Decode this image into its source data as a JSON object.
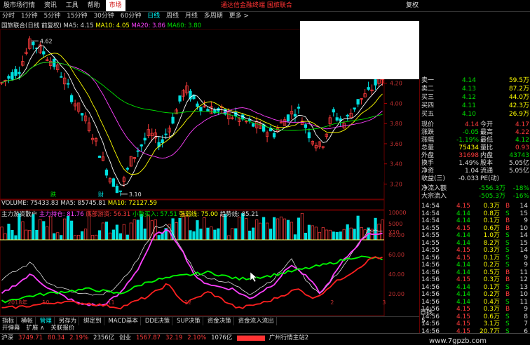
{
  "menu": {
    "items": [
      "股市场行情",
      "资讯",
      "工具",
      "帮助",
      "市场"
    ],
    "promo": "通达信金融终端  国旅联合",
    "right_label": "复权"
  },
  "periods": {
    "items": [
      "分时",
      "1分钟",
      "5分钟",
      "15分钟",
      "30分钟",
      "60分钟",
      "日线",
      "周线",
      "月线",
      "多周期",
      "更多 >"
    ],
    "selected_index": 6
  },
  "main_chart": {
    "legend_name": "国旅联合(日线 前复权)",
    "ma5": "MA5: 4.15",
    "ma10": "MA10: 4.05",
    "ma20": "MA20: 3.86",
    "ma60": "MA60: 3.80",
    "high_label": "4.62",
    "low_label": "3.10",
    "hint_left": "跌",
    "hint_right": "财",
    "y_ticks": [
      "4.20",
      "4.00",
      "3.80",
      "3.60",
      "3.40",
      "3.20"
    ]
  },
  "volume_chart": {
    "label": "VOLUME: 75433.83",
    "ma5": "MA5: 85745.81",
    "ma10": "MA10: 72127.59",
    "y_ticks": [
      "10000",
      "5000",
      "X10"
    ]
  },
  "indicator_chart": {
    "name": "主力游资散户",
    "l1": "主力持仓: 81.76",
    "l2": "底部游资: 56.31",
    "l3": "小散买入: 57.51",
    "l4": "强弱线: 75.00",
    "l5": "趋势线: 85.21",
    "y_ticks": [
      "80.00",
      "60.00",
      "40.00",
      "20.00"
    ]
  },
  "x_axis": {
    "labels": [
      "2018年",
      "10",
      "11",
      "12",
      "2",
      "3"
    ]
  },
  "quotes": {
    "sell": [
      {
        "name": "卖一",
        "price": "4.14",
        "vol": "59.5万"
      },
      {
        "name": "卖二",
        "price": "4.13",
        "vol": "87.2万"
      },
      {
        "name": "买三",
        "price": "4.12",
        "vol": "44.0万"
      },
      {
        "name": "买四",
        "price": "4.11",
        "vol": "42.3万"
      },
      {
        "name": "买五",
        "price": "4.10",
        "vol": "26.9万"
      }
    ],
    "stats": [
      [
        "现价",
        "4.14",
        "今开",
        "4.17"
      ],
      [
        "涨跌",
        "-0.05",
        "最高",
        "4.22"
      ],
      [
        "涨幅",
        "-1.19%",
        "最低",
        "4.12"
      ],
      [
        "总量",
        "75434",
        "量比",
        "0.93"
      ],
      [
        "外盘",
        "31698",
        "内盘",
        "43743"
      ],
      [
        "换手",
        "1.49%",
        "股本",
        "5.05亿"
      ],
      [
        "净资",
        "1.04",
        "流通",
        "5.05亿"
      ],
      [
        "收益(三)",
        "-0.033",
        "PE(动)",
        ""
      ]
    ],
    "flow": [
      [
        "净流入额",
        "-556.3万",
        "-18%"
      ],
      [
        "大宗流入",
        "-505.3万",
        "-16%"
      ]
    ],
    "ticks": [
      [
        "14:54",
        "4.15",
        "0.3万",
        "B",
        "14"
      ],
      [
        "14:54",
        "4.14",
        "0.8万",
        "S",
        "15"
      ],
      [
        "14:54",
        "4.14",
        "0.1万",
        "B",
        "9"
      ],
      [
        "14:55",
        "4.15",
        "0.6万",
        "B",
        "10"
      ],
      [
        "14:55",
        "4.14",
        "1.0万",
        "S",
        "14"
      ],
      [
        "14:55",
        "4.14",
        "8.2万",
        "S",
        "15"
      ],
      [
        "14:55",
        "4.15",
        "0.3万",
        "S",
        "14"
      ],
      [
        "14:56",
        "4.15",
        "0.1万",
        "S",
        "9"
      ],
      [
        "14:56",
        "4.14",
        "0.2万",
        "S",
        "9"
      ],
      [
        "14:56",
        "4.14",
        "0.5万",
        "B",
        "11"
      ],
      [
        "14:56",
        "4.15",
        "0.3万",
        "B",
        "12"
      ],
      [
        "14:56",
        "4.14",
        "0.1万",
        "S",
        "13"
      ],
      [
        "14:56",
        "4.14",
        "0.2万",
        "B",
        "10"
      ],
      [
        "14:56",
        "4.14",
        "0.4万",
        "S",
        "11"
      ],
      [
        "14:56",
        "4.15",
        "0.3万",
        "B",
        "9"
      ],
      [
        "14:56",
        "4.15",
        "0.6万",
        "S",
        "8"
      ],
      [
        "14:56",
        "4.15",
        "3.1万",
        "S",
        "7"
      ],
      [
        "14:56",
        "4.15",
        "20.7万",
        "S",
        "6"
      ]
    ],
    "bottom_tabs": [
      "日线",
      "5"
    ]
  },
  "bottom_tabs": {
    "items": [
      "指标",
      "横帐",
      "管理",
      "另存为",
      "绑定到",
      "MACD基本",
      "DDE决策",
      "SUP决策",
      "资金决策",
      "资金流入流出"
    ],
    "selected_index": 2
  },
  "bottom_tabs2": {
    "items": [
      "开弹幕",
      "扩展 ∧",
      "关联报价"
    ]
  },
  "status": {
    "sh_label": "沪深",
    "sh_val": "3749.71",
    "sh_chg": "80.34",
    "sh_pct": "2.19%",
    "sh_amt": "2356亿",
    "cy_label": "创业",
    "cy_val": "1567.87",
    "cy_chg": "32.19",
    "cy_pct": "2.10%",
    "cy_amt": "1076亿",
    "site": "广州行情主站2"
  },
  "watermark": "www.7gpzb.com",
  "colors": {
    "up": "#ff3c3c",
    "down": "#00e0e0",
    "ma5": "#ffffff",
    "ma10": "#ffff00",
    "ma20": "#ff40ff",
    "ma60": "#00e000"
  }
}
